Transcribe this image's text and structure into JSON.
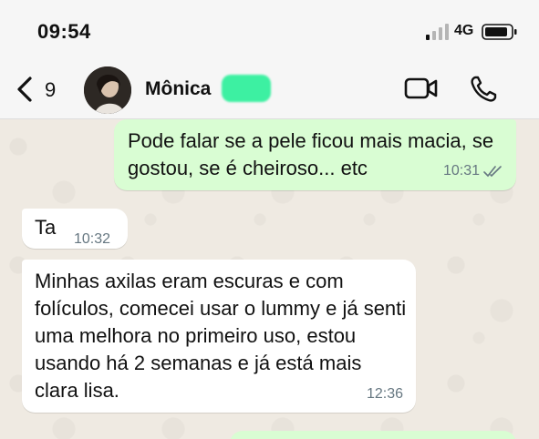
{
  "status_bar": {
    "time": "09:54",
    "network": "4G"
  },
  "header": {
    "back_count": "9",
    "contact_name": "Mônica"
  },
  "messages": [
    {
      "direction": "outgoing",
      "text": "Pode falar se a pele ficou mais macia, se gostou, se é cheiroso... etc",
      "time": "10:31",
      "read": true
    },
    {
      "direction": "incoming",
      "text": "Ta",
      "time": "10:32"
    },
    {
      "direction": "incoming",
      "text": "Minhas axilas eram escuras e com folículos,  comecei usar o lummy e já senti uma melhora no primeiro uso, estou usando há 2 semanas e já está mais clara lisa.",
      "time": "12:36"
    }
  ],
  "colors": {
    "outgoing_bubble": "#d9fdd3",
    "incoming_bubble": "#ffffff",
    "chat_background": "#efeae2",
    "read_check": "#53bdeb"
  },
  "icons": [
    "signal-icon",
    "battery-icon",
    "back-chevron-icon",
    "video-call-icon",
    "phone-call-icon",
    "read-receipt-icon"
  ]
}
